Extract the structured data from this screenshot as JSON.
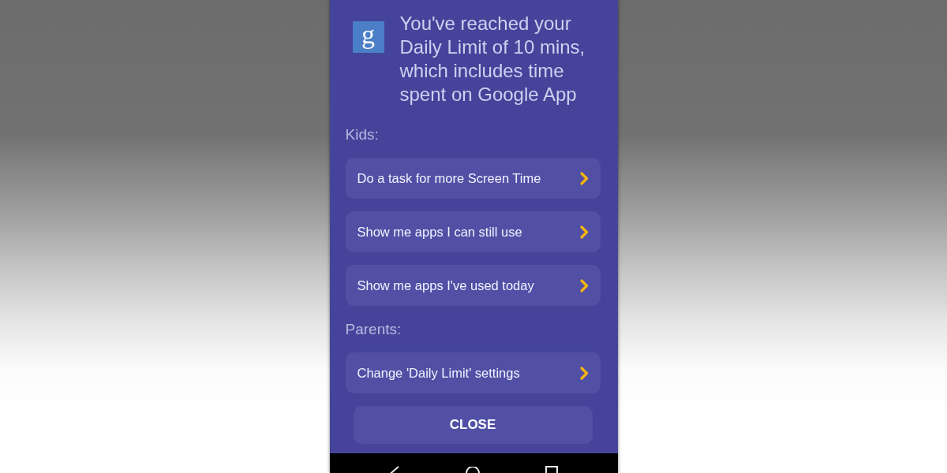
{
  "dialog": {
    "app_icon": {
      "glyph": "g"
    },
    "message": "You've reached your Daily Limit of 10 mins, which includes time spent on Google App",
    "sections": [
      {
        "heading": "Kids:",
        "options": [
          {
            "label": "Do a task for more Screen Time"
          },
          {
            "label": "Show me apps I can still use"
          },
          {
            "label": "Show me apps I've used today"
          }
        ]
      },
      {
        "heading": "Parents:",
        "options": [
          {
            "label": "Change 'Daily Limit' settings"
          }
        ]
      }
    ],
    "close_button": "CLOSE"
  }
}
